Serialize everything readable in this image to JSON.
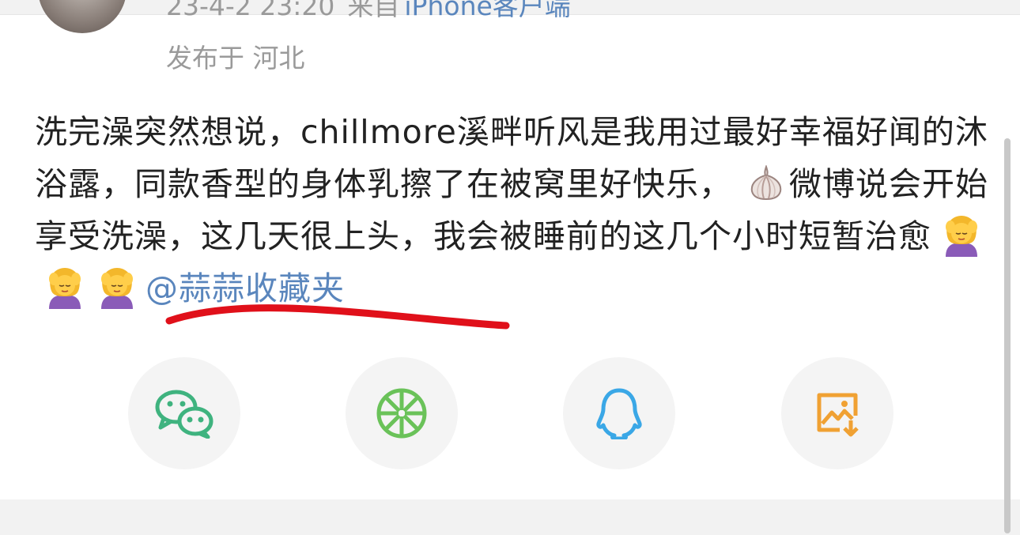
{
  "post": {
    "meta": {
      "datetime": "23-4-2 23:20",
      "source": "来自",
      "device": "iPhone客户端",
      "location": "发布于 河北"
    },
    "text": {
      "part1": "洗完澡突然想说，chillmore溪畔听风是我用过最好幸福好闻的沐浴露，同款香型的身体乳擦了在被窝里好快乐，",
      "part2": "微博说会开始享受洗澡，这几天很上头，我会被睡前的这几个小时短暂治愈",
      "mention": "@蒜蒜收藏夹"
    }
  },
  "share": {
    "buttons": [
      {
        "icon": "wechat-icon",
        "color": "#3fb37f"
      },
      {
        "icon": "moments-icon",
        "color": "#6ac259"
      },
      {
        "icon": "qq-icon",
        "color": "#3aa7e6"
      },
      {
        "icon": "save-image-icon",
        "color": "#f0a133"
      }
    ]
  },
  "colors": {
    "link": "#5a86bd",
    "meta_text": "#9a9a9a",
    "body_text": "#222222",
    "annotation_red": "#e0101a"
  }
}
